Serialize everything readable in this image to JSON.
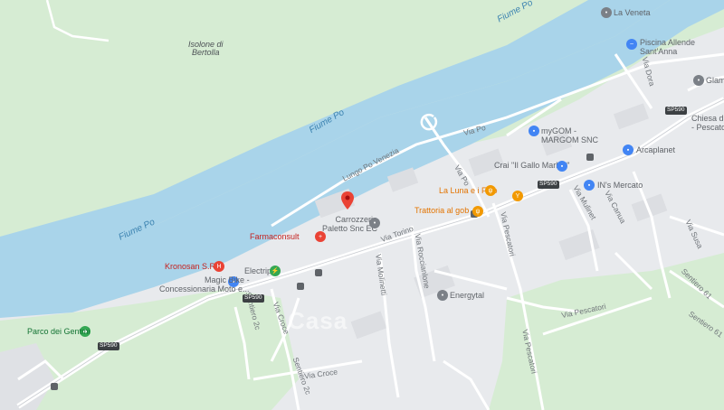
{
  "map": {
    "colors": {
      "land": "#e8eaed",
      "green": "#d6ecd3",
      "water": "#a9d4ea",
      "road_main": "#ffffff",
      "road_minor": "#ffffff"
    },
    "water_labels": {
      "river_1": "Fiume Po",
      "river_2": "Fiume Po",
      "river_3": "Fiume Po"
    },
    "areas": {
      "island": "Isolone di\nBertolla",
      "park": "Parco dei Gentmi"
    },
    "roads": {
      "via_torino_1": "Via Torino",
      "via_torino_2": "Via Torino",
      "lungo_po": "Lungo Po Venezia",
      "via_po": "Via Po",
      "via_roccianlone": "Via Roccianlone",
      "via_molinetti": "Via Molinetti",
      "via_croce_1": "Via Croce",
      "via_croce_2": "Via Croce",
      "via_pescatori_1": "Via Pescatori",
      "via_pescatori_2": "Via Pescatori",
      "via_pescatori_3": "Via Pescatori",
      "via_mulinet": "Via Mulinet",
      "via_canua": "Via Canua",
      "via_susa": "Via Susa",
      "via_dora": "Via Dora",
      "via_pio": "Via Pio",
      "sentiero_61": "Sentiero 61",
      "sentiero_61b": "Sentiero 61",
      "sentiero_2": "Sentiero 2c",
      "sentiero_3": "Sentiero 2c"
    },
    "shields": [
      "SP590",
      "SP590",
      "SP590",
      "SP590"
    ],
    "pois": {
      "la_veneta": "La Veneta",
      "piscina": "Piscina Allende\nSant'Anna",
      "glamis": "Glami",
      "chiesa": "Chiesa di S\n- Pescatori",
      "mygom": "myGOM -\nMARGOM SNC",
      "arcaplanet": "Arcaplanet",
      "crai": "Crai \"Il Gallo Market\"",
      "ins": "IN's Mercato",
      "la_luna": "La Luna e i Falò",
      "trattoria": "Trattoria al gob",
      "carrozzeria": "Carrozzeria\nPaletto Snc EC",
      "farmaconsult": "Farmaconsult",
      "kronosan": "Kronosan S.R.L",
      "electrip": "Electrip",
      "magic_bike": "Magic Bike -\nConcessionaria Moto e...",
      "energytal": "Energytal"
    },
    "watermark": "Casa"
  }
}
